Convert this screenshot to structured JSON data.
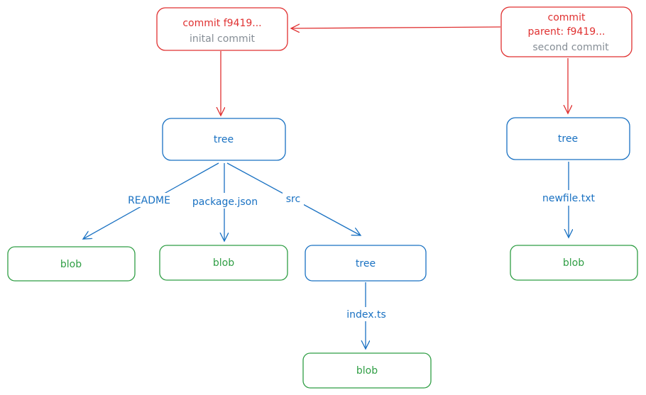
{
  "colors": {
    "commit": "#e03131",
    "tree": "#1971c2",
    "blob": "#2f9e44",
    "message": "#868e96"
  },
  "commit1": {
    "title": "commit f9419...",
    "message": "inital commit"
  },
  "commit2": {
    "title": "commit",
    "parent": "parent: f9419...",
    "message": "second commit"
  },
  "tree1": {
    "label": "tree"
  },
  "tree2": {
    "label": "tree"
  },
  "tree3": {
    "label": "tree"
  },
  "blobs": [
    {
      "label": "blob"
    },
    {
      "label": "blob"
    },
    {
      "label": "blob"
    },
    {
      "label": "blob"
    }
  ],
  "edges": {
    "readme": "README",
    "package": "package.json",
    "src": "src",
    "index": "index.ts",
    "newfile": "newfile.txt"
  }
}
